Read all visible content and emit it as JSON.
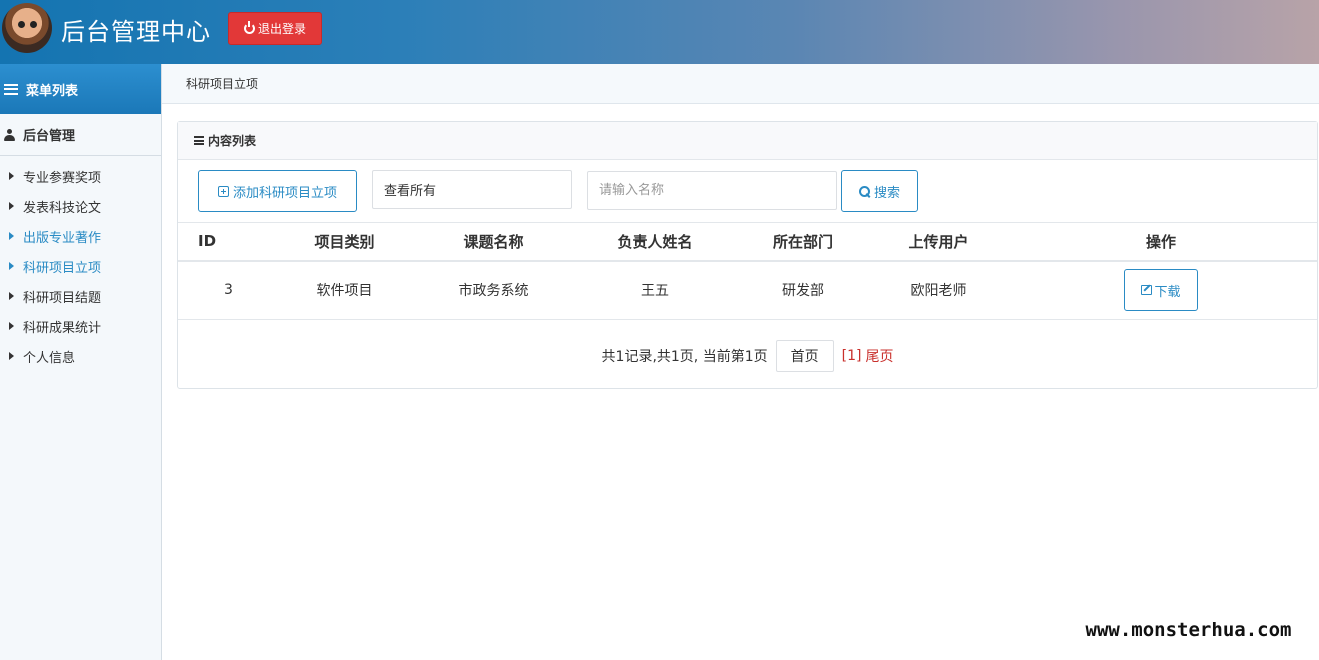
{
  "header": {
    "title": "后台管理中心",
    "logout_label": "退出登录"
  },
  "sidebar": {
    "menu_title": "菜单列表",
    "group_title": "后台管理",
    "items": [
      {
        "label": "专业参赛奖项",
        "active": false
      },
      {
        "label": "发表科技论文",
        "active": false
      },
      {
        "label": "出版专业著作",
        "active": true
      },
      {
        "label": "科研项目立项",
        "active": true
      },
      {
        "label": "科研项目结题",
        "active": false
      },
      {
        "label": "科研成果统计",
        "active": false
      },
      {
        "label": "个人信息",
        "active": false
      }
    ]
  },
  "breadcrumb": "科研项目立项",
  "panel": {
    "title": "内容列表",
    "add_label": "添加科研项目立项",
    "view_select": "查看所有",
    "search_placeholder": "请输入名称",
    "search_label": "搜索"
  },
  "table": {
    "headers": [
      "ID",
      "项目类别",
      "课题名称",
      "负责人姓名",
      "所在部门",
      "上传用户",
      "操作"
    ],
    "rows": [
      {
        "id": "3",
        "type": "软件项目",
        "name": "市政务系统",
        "owner": "王五",
        "dept": "研发部",
        "uploader": "欧阳老师",
        "action": "下载"
      }
    ]
  },
  "pager": {
    "summary": "共1记录,共1页, 当前第1页",
    "first": "首页",
    "current": "[1]",
    "last": "尾页"
  },
  "watermark": "www.monsterhua.com"
}
